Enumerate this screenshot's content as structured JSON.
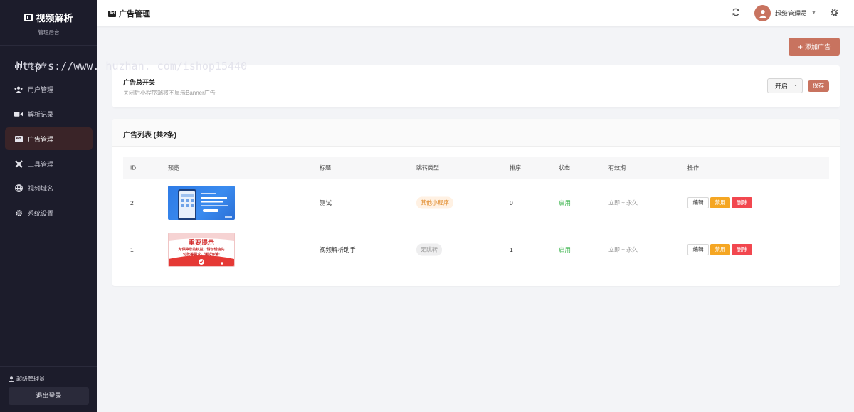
{
  "brand": {
    "title": "视频解析",
    "subtitle": "管理后台"
  },
  "watermark": "http s://www. huzhan. com/ishop15440",
  "sidebar": {
    "items": [
      {
        "label": "仪表盘",
        "icon": "dashboard-icon"
      },
      {
        "label": "用户管理",
        "icon": "users-icon"
      },
      {
        "label": "解析记录",
        "icon": "video-icon"
      },
      {
        "label": "广告管理",
        "icon": "ad-icon",
        "active": true
      },
      {
        "label": "工具管理",
        "icon": "tools-icon"
      },
      {
        "label": "视频域名",
        "icon": "globe-icon"
      },
      {
        "label": "系统设置",
        "icon": "gear-icon"
      }
    ],
    "footer_user": "超级管理员",
    "logout": "退出登录"
  },
  "header": {
    "title": "广告管理",
    "user": "超级管理员"
  },
  "toolbar": {
    "add_label": "添加广告"
  },
  "switch": {
    "title": "广告总开关",
    "desc": "关闭后小程序端将不显示Banner广告",
    "value": "开启",
    "save": "保存"
  },
  "list": {
    "title": "广告列表 (共2条)",
    "columns": [
      "ID",
      "预览",
      "标题",
      "跳转类型",
      "排序",
      "状态",
      "有效期",
      "操作"
    ],
    "rows": [
      {
        "id": "2",
        "title": "测试",
        "jump": "其他小程序",
        "sort": "0",
        "status": "启用",
        "validity": "立即 ~ 永久"
      },
      {
        "id": "1",
        "title": "视频解析助手",
        "jump": "无跳转",
        "sort": "1",
        "status": "启用",
        "validity": "立即 ~ 永久"
      }
    ],
    "actions": {
      "edit": "编辑",
      "disable": "禁用",
      "delete": "删除"
    },
    "thumb2": {
      "heading": "重要提示",
      "line1": "为保障您的权益，请勿轻信先",
      "line2": "付款等要求，谨防诈骗!"
    }
  },
  "colors": {
    "accent": "#c8735f",
    "sidebar_bg": "#1c1c2b",
    "warning": "#f5a623",
    "danger": "#f2474f",
    "success": "#3fb650"
  }
}
